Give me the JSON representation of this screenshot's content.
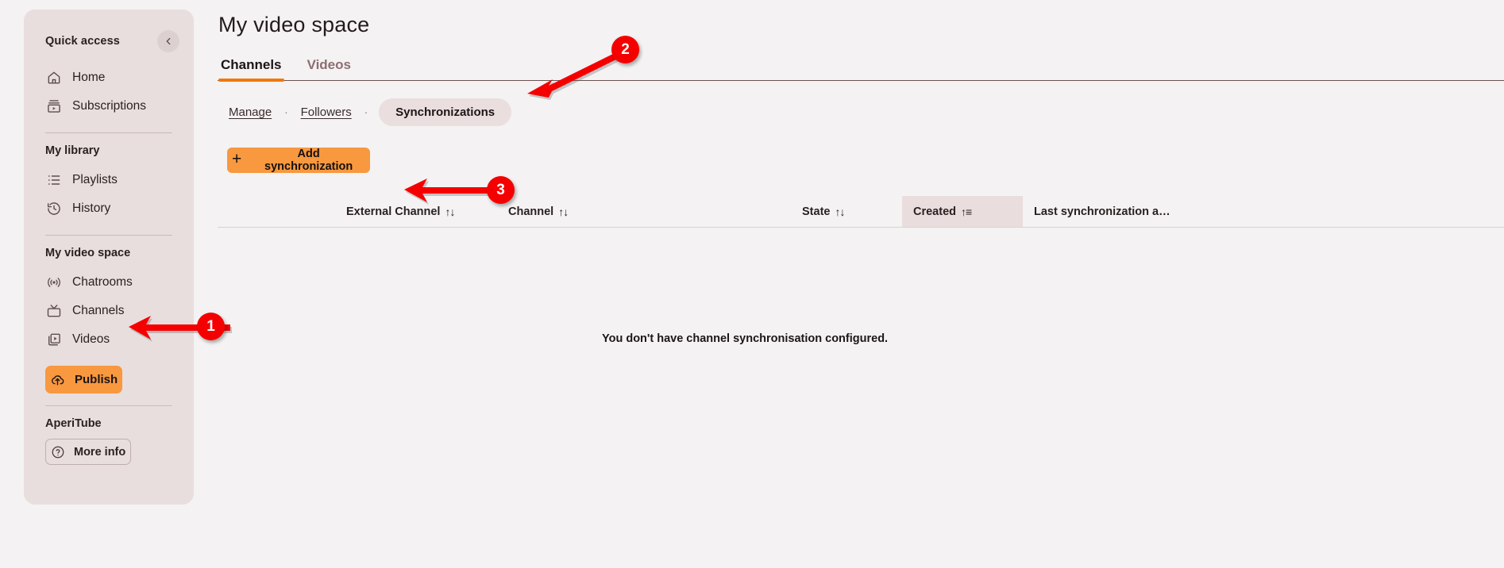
{
  "app": {
    "background_color": "#f4f2f2",
    "sidebar_color": "#e9dede",
    "accent_color": "#f8983f",
    "tab_underline_color": "#f2770d",
    "annotation_color": "#f50000"
  },
  "sidebar": {
    "quick_access": {
      "title": "Quick access",
      "collapse_icon": "chevron-left-icon",
      "items": [
        {
          "label": "Home",
          "icon": "home-icon"
        },
        {
          "label": "Subscriptions",
          "icon": "subscriptions-icon"
        }
      ]
    },
    "my_library": {
      "title": "My library",
      "items": [
        {
          "label": "Playlists",
          "icon": "playlist-icon"
        },
        {
          "label": "History",
          "icon": "history-icon"
        }
      ]
    },
    "my_video_space": {
      "title": "My video space",
      "items": [
        {
          "label": "Chatrooms",
          "icon": "broadcast-icon"
        },
        {
          "label": "Channels",
          "icon": "tv-icon"
        },
        {
          "label": "Videos",
          "icon": "videos-icon"
        }
      ],
      "publish_label": "Publish",
      "publish_icon": "upload-cloud-icon"
    },
    "instance": {
      "title": "AperiTube",
      "more_info_label": "More info",
      "more_info_icon": "question-circle-icon"
    }
  },
  "main": {
    "page_title": "My video space",
    "tabs": [
      {
        "label": "Channels",
        "active": true
      },
      {
        "label": "Videos",
        "active": false
      }
    ],
    "subtabs": [
      {
        "label": "Manage",
        "active": false
      },
      {
        "label": "Followers",
        "active": false
      },
      {
        "label": "Synchronizations",
        "active": true
      }
    ],
    "subtab_separator": "·",
    "add_button": {
      "label": "Add synchronization",
      "icon": "plus-icon"
    },
    "table": {
      "columns": [
        {
          "label": "External Channel",
          "sort": "↑↓",
          "sorted": false
        },
        {
          "label": "Channel",
          "sort": "↑↓",
          "sorted": false
        },
        {
          "label": "State",
          "sort": "↑↓",
          "sorted": false
        },
        {
          "label": "Created",
          "sort": "↑≡",
          "sorted": true
        },
        {
          "label": "Last synchronization a…",
          "sort": "",
          "sorted": false
        }
      ],
      "rows": [],
      "empty_message": "You don't have channel synchronisation configured."
    }
  },
  "annotations": [
    {
      "number": "1",
      "target": "sidebar-item-channels"
    },
    {
      "number": "2",
      "target": "subtab-synchronizations"
    },
    {
      "number": "3",
      "target": "add-synchronization-button"
    }
  ]
}
